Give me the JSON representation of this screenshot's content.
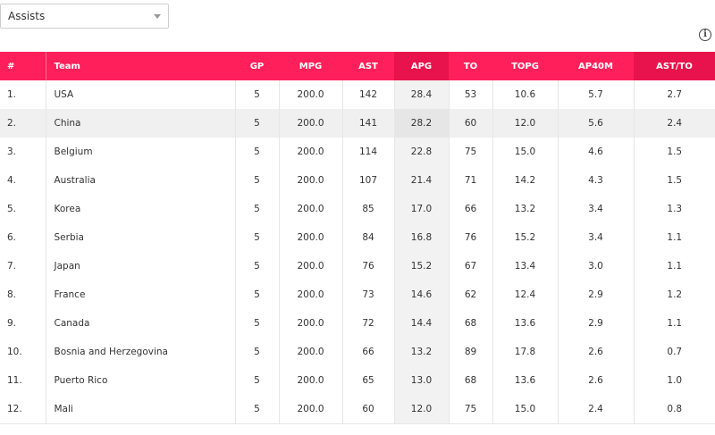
{
  "stat_select": {
    "value": "Assists"
  },
  "info_icon": {
    "glyph": "i"
  },
  "table": {
    "columns": [
      "#",
      "Team",
      "GP",
      "MPG",
      "AST",
      "APG",
      "TO",
      "TOPG",
      "AP40M",
      "AST/TO"
    ],
    "rows": [
      [
        "1.",
        "USA",
        "5",
        "200.0",
        "142",
        "28.4",
        "53",
        "10.6",
        "5.7",
        "2.7"
      ],
      [
        "2.",
        "China",
        "5",
        "200.0",
        "141",
        "28.2",
        "60",
        "12.0",
        "5.6",
        "2.4"
      ],
      [
        "3.",
        "Belgium",
        "5",
        "200.0",
        "114",
        "22.8",
        "75",
        "15.0",
        "4.6",
        "1.5"
      ],
      [
        "4.",
        "Australia",
        "5",
        "200.0",
        "107",
        "21.4",
        "71",
        "14.2",
        "4.3",
        "1.5"
      ],
      [
        "5.",
        "Korea",
        "5",
        "200.0",
        "85",
        "17.0",
        "66",
        "13.2",
        "3.4",
        "1.3"
      ],
      [
        "6.",
        "Serbia",
        "5",
        "200.0",
        "84",
        "16.8",
        "76",
        "15.2",
        "3.4",
        "1.1"
      ],
      [
        "7.",
        "Japan",
        "5",
        "200.0",
        "76",
        "15.2",
        "67",
        "13.4",
        "3.0",
        "1.1"
      ],
      [
        "8.",
        "France",
        "5",
        "200.0",
        "73",
        "14.6",
        "62",
        "12.4",
        "2.9",
        "1.2"
      ],
      [
        "9.",
        "Canada",
        "5",
        "200.0",
        "72",
        "14.4",
        "68",
        "13.6",
        "2.9",
        "1.1"
      ],
      [
        "10.",
        "Bosnia and Herzegovina",
        "5",
        "200.0",
        "66",
        "13.2",
        "89",
        "17.8",
        "2.6",
        "0.7"
      ],
      [
        "11.",
        "Puerto Rico",
        "5",
        "200.0",
        "65",
        "13.0",
        "68",
        "13.6",
        "2.6",
        "1.0"
      ],
      [
        "12.",
        "Mali",
        "5",
        "200.0",
        "60",
        "12.0",
        "75",
        "15.0",
        "2.4",
        "0.8"
      ]
    ]
  },
  "colors": {
    "header": "#ff1f5a",
    "header_sorted": "#e8134c",
    "sorted_column": "#f2f2f2"
  }
}
